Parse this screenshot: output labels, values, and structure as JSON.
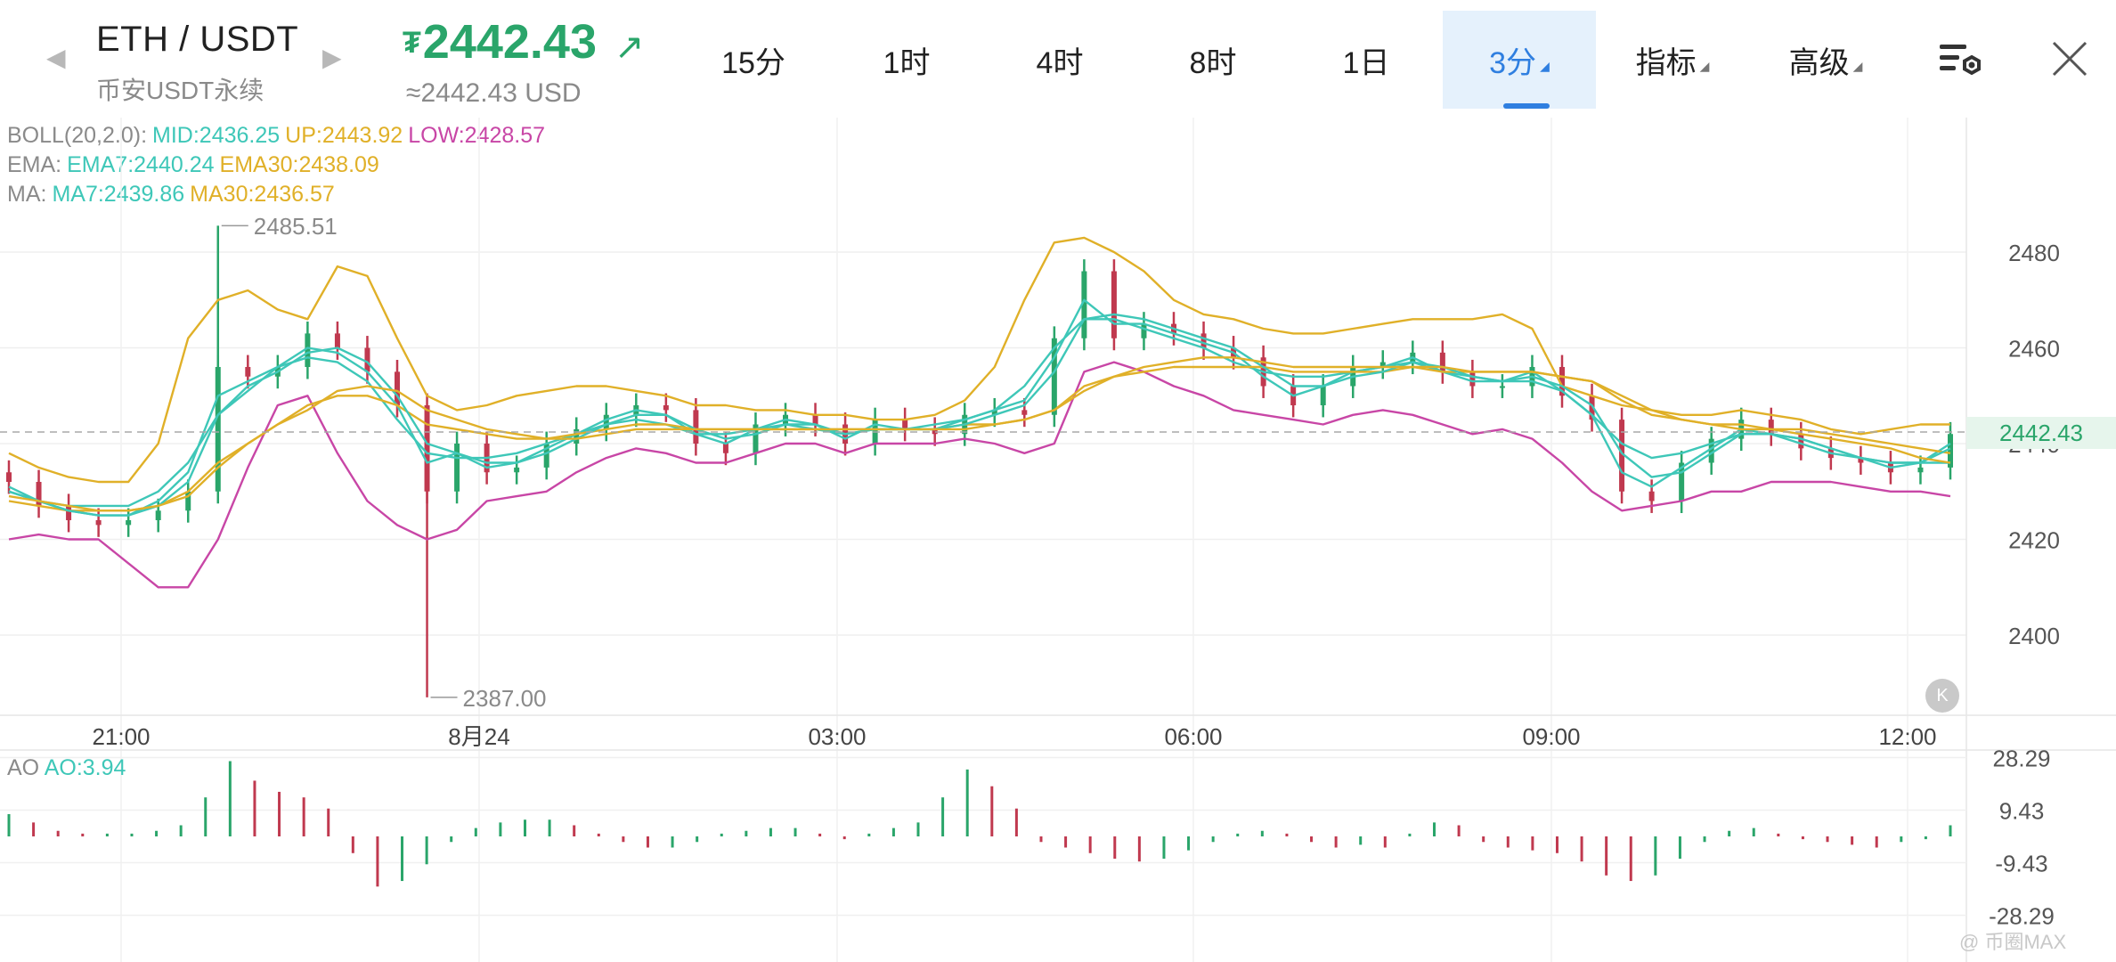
{
  "header": {
    "pair": "ETH / USDT",
    "market": "币安USDT永续",
    "price_symbol": "₮",
    "price": "2442.43",
    "price_usd": "≈2442.43 USD",
    "price_color": "#2aa56a"
  },
  "tabs": [
    {
      "label": "15分",
      "active": false,
      "dropdown": false
    },
    {
      "label": "1时",
      "active": false,
      "dropdown": false
    },
    {
      "label": "4时",
      "active": false,
      "dropdown": false
    },
    {
      "label": "8时",
      "active": false,
      "dropdown": false
    },
    {
      "label": "1日",
      "active": false,
      "dropdown": false
    },
    {
      "label": "3分",
      "active": true,
      "dropdown": true
    },
    {
      "label": "指标",
      "active": false,
      "dropdown": true
    },
    {
      "label": "高级",
      "active": false,
      "dropdown": true
    }
  ],
  "icons": {
    "settings": "chart-settings-icon",
    "close": "close-icon",
    "back": "back-to-latest-icon",
    "nav_prev": "chevron-left-icon",
    "nav_next": "chevron-right-icon",
    "trend": "arrow-up-right-icon"
  },
  "indicators": {
    "boll": {
      "label": "BOLL(20,2.0):",
      "mid": "MID:2436.25",
      "up": "UP:2443.92",
      "low": "LOW:2428.57"
    },
    "ema": {
      "label": "EMA:",
      "ema7": "EMA7:2440.24",
      "ema30": "EMA30:2438.09"
    },
    "ma": {
      "label": "MA:",
      "ma7": "MA7:2439.86",
      "ma30": "MA30:2436.57"
    },
    "ao": {
      "label": "AO",
      "value": "AO:3.94"
    }
  },
  "current_price_tag": "2442.43",
  "watermark": "@ 币圈MAX",
  "colors": {
    "up": "#2aa56a",
    "down": "#c0394f",
    "mid": "#3ec7b8",
    "upper": "#e0b028",
    "lower": "#c846a6",
    "accent": "#2f7fe0"
  },
  "chart_data": [
    {
      "type": "candlestick",
      "title": "",
      "x_ticks": [
        "21:00",
        "8月24",
        "03:00",
        "06:00",
        "09:00",
        "12:00"
      ],
      "y_ticks": [
        2480,
        2460,
        2440,
        2420,
        2400
      ],
      "ylim": [
        2383,
        2495
      ],
      "grid": true,
      "high_label": "2485.51",
      "low_label": "2387.00",
      "high": 2485.51,
      "low": 2387.0,
      "last_price": 2442.43,
      "close_approx": [
        2432,
        2427,
        2424,
        2423,
        2424,
        2426,
        2430,
        2456,
        2454,
        2456,
        2463,
        2460,
        2455,
        2448,
        2430,
        2440,
        2434,
        2435,
        2440,
        2443,
        2446,
        2448,
        2447,
        2440,
        2438,
        2444,
        2446,
        2444,
        2440,
        2445,
        2443,
        2442,
        2446,
        2447,
        2446,
        2462,
        2476,
        2462,
        2465,
        2463,
        2460,
        2458,
        2452,
        2448,
        2452,
        2456,
        2457,
        2459,
        2455,
        2452,
        2452,
        2456,
        2450,
        2445,
        2430,
        2428,
        2436,
        2441,
        2445,
        2442,
        2439,
        2437,
        2436,
        2434,
        2435,
        2442
      ],
      "series": [
        {
          "name": "MID",
          "values": [
            2430,
            2428,
            2427,
            2427,
            2427,
            2430,
            2436,
            2446,
            2451,
            2456,
            2458,
            2457,
            2453,
            2445,
            2438,
            2437,
            2437,
            2438,
            2440,
            2442,
            2444,
            2445,
            2444,
            2442,
            2442,
            2443,
            2444,
            2443,
            2442,
            2443,
            2443,
            2444,
            2445,
            2447,
            2452,
            2460,
            2466,
            2466,
            2464,
            2462,
            2460,
            2457,
            2455,
            2454,
            2454,
            2455,
            2456,
            2457,
            2455,
            2454,
            2453,
            2453,
            2451,
            2446,
            2440,
            2437,
            2438,
            2440,
            2442,
            2442,
            2441,
            2439,
            2437,
            2436,
            2436,
            2436
          ]
        },
        {
          "name": "UP",
          "values": [
            2438,
            2435,
            2433,
            2432,
            2432,
            2440,
            2462,
            2470,
            2472,
            2468,
            2466,
            2477,
            2475,
            2462,
            2450,
            2447,
            2448,
            2450,
            2451,
            2452,
            2452,
            2451,
            2450,
            2448,
            2448,
            2447,
            2447,
            2446,
            2446,
            2445,
            2445,
            2446,
            2449,
            2456,
            2470,
            2482,
            2483,
            2480,
            2476,
            2470,
            2467,
            2466,
            2464,
            2463,
            2463,
            2464,
            2465,
            2466,
            2466,
            2466,
            2467,
            2464,
            2452,
            2450,
            2448,
            2447,
            2446,
            2446,
            2447,
            2446,
            2445,
            2443,
            2442,
            2443,
            2444,
            2444
          ]
        },
        {
          "name": "LOW",
          "values": [
            2420,
            2421,
            2420,
            2420,
            2415,
            2410,
            2410,
            2420,
            2435,
            2448,
            2450,
            2438,
            2428,
            2423,
            2420,
            2422,
            2428,
            2429,
            2430,
            2434,
            2437,
            2439,
            2438,
            2436,
            2436,
            2438,
            2440,
            2440,
            2438,
            2440,
            2440,
            2440,
            2441,
            2440,
            2438,
            2440,
            2455,
            2457,
            2455,
            2452,
            2450,
            2447,
            2446,
            2445,
            2444,
            2446,
            2447,
            2446,
            2444,
            2442,
            2443,
            2441,
            2436,
            2430,
            2426,
            2427,
            2428,
            2430,
            2430,
            2432,
            2432,
            2432,
            2431,
            2430,
            2430,
            2429
          ]
        },
        {
          "name": "EMA7",
          "values": [
            2431,
            2428,
            2426,
            2425,
            2425,
            2428,
            2434,
            2450,
            2453,
            2456,
            2460,
            2459,
            2455,
            2448,
            2436,
            2438,
            2435,
            2436,
            2439,
            2442,
            2445,
            2447,
            2446,
            2442,
            2440,
            2443,
            2445,
            2444,
            2441,
            2444,
            2443,
            2443,
            2445,
            2447,
            2449,
            2458,
            2470,
            2465,
            2465,
            2463,
            2461,
            2459,
            2454,
            2450,
            2452,
            2455,
            2456,
            2458,
            2455,
            2453,
            2453,
            2455,
            2451,
            2446,
            2434,
            2431,
            2435,
            2439,
            2443,
            2442,
            2440,
            2438,
            2437,
            2435,
            2436,
            2440
          ]
        },
        {
          "name": "EMA30",
          "values": [
            2428,
            2427,
            2426,
            2426,
            2426,
            2427,
            2430,
            2436,
            2440,
            2444,
            2448,
            2450,
            2450,
            2448,
            2444,
            2443,
            2442,
            2441,
            2441,
            2442,
            2443,
            2444,
            2444,
            2443,
            2443,
            2443,
            2443,
            2443,
            2443,
            2443,
            2443,
            2443,
            2444,
            2444,
            2445,
            2447,
            2452,
            2454,
            2455,
            2456,
            2456,
            2456,
            2456,
            2455,
            2455,
            2455,
            2455,
            2456,
            2455,
            2455,
            2455,
            2455,
            2454,
            2453,
            2449,
            2446,
            2445,
            2444,
            2444,
            2443,
            2443,
            2442,
            2441,
            2440,
            2439,
            2438
          ]
        },
        {
          "name": "MA7",
          "values": [
            2430,
            2428,
            2426,
            2425,
            2425,
            2427,
            2432,
            2446,
            2452,
            2455,
            2459,
            2460,
            2457,
            2450,
            2440,
            2438,
            2436,
            2436,
            2438,
            2441,
            2444,
            2446,
            2446,
            2443,
            2441,
            2442,
            2444,
            2444,
            2442,
            2443,
            2443,
            2443,
            2444,
            2446,
            2448,
            2455,
            2466,
            2467,
            2466,
            2464,
            2462,
            2460,
            2456,
            2452,
            2452,
            2454,
            2455,
            2457,
            2456,
            2454,
            2453,
            2454,
            2452,
            2448,
            2438,
            2433,
            2434,
            2438,
            2442,
            2442,
            2441,
            2439,
            2437,
            2436,
            2436,
            2439
          ]
        },
        {
          "name": "MA30",
          "values": [
            2429,
            2428,
            2427,
            2426,
            2426,
            2427,
            2429,
            2435,
            2440,
            2444,
            2447,
            2451,
            2452,
            2451,
            2447,
            2445,
            2443,
            2442,
            2441,
            2441,
            2442,
            2443,
            2443,
            2443,
            2443,
            2443,
            2443,
            2443,
            2443,
            2443,
            2443,
            2443,
            2443,
            2444,
            2445,
            2447,
            2451,
            2454,
            2456,
            2457,
            2458,
            2458,
            2457,
            2456,
            2456,
            2456,
            2456,
            2456,
            2456,
            2455,
            2455,
            2455,
            2454,
            2453,
            2450,
            2447,
            2445,
            2444,
            2443,
            2443,
            2442,
            2441,
            2440,
            2439,
            2437,
            2436
          ]
        }
      ]
    },
    {
      "type": "bar",
      "title": "AO",
      "y_ticks": [
        "28.29",
        "9.43",
        "-9.43",
        "-28.29"
      ],
      "ylim": [
        -30,
        31
      ],
      "series": [
        {
          "name": "AO",
          "values": [
            8,
            5,
            2,
            1,
            1,
            1,
            2,
            4,
            14,
            27,
            20,
            16,
            14,
            10,
            -6,
            -18,
            -16,
            -10,
            -2,
            3,
            5,
            6,
            6,
            4,
            1,
            -2,
            -4,
            -4,
            -2,
            1,
            2,
            3,
            3,
            1,
            -1,
            1,
            3,
            5,
            14,
            24,
            18,
            10,
            -2,
            -4,
            -6,
            -8,
            -9,
            -8,
            -5,
            -2,
            1,
            2,
            1,
            -2,
            -4,
            -3,
            -4,
            1,
            5,
            4,
            -2,
            -4,
            -5,
            -6,
            -9,
            -14,
            -16,
            -14,
            -8,
            -2,
            2,
            3,
            1,
            -1,
            -2,
            -3,
            -4,
            -2,
            -1,
            4
          ]
        }
      ]
    }
  ]
}
